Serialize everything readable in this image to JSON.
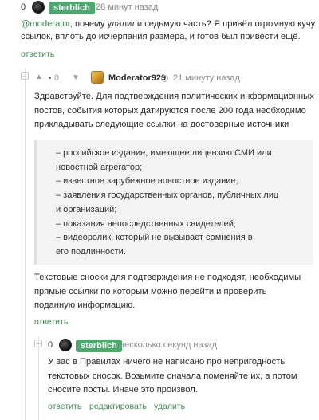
{
  "comment1": {
    "rating": "0",
    "author": "sterblich",
    "time": "28 минут назад",
    "mention": "@moderator",
    "text_rest": ", почему удалили седьмую часть? Я привёл огромную кучу",
    "text_line2": "ссылок, вплоть до исчерпания размера, и готов был привести ещё.",
    "reply_label": "ответить"
  },
  "comment2": {
    "rating": "0",
    "author": "Moderator929",
    "time": "21 минуту назад",
    "intro_lines": [
      "Здравствуйте. Для подтверждения политических информационных",
      "постов, события которых датируются после 200 года необходимо",
      "прикладывать следующие ссылки на достоверные источники"
    ],
    "quote_lines": [
      "– российское издание, имеющее лицензию СМИ или",
      "новостной агрегатор;",
      "– известное зарубежное новостное издание;",
      "– заявления государственных органов, публичных лиц",
      "и организаций;",
      "– показания непосредственных свидетелей;",
      "– видеоролик, который не вызывает сомнения в",
      "его подлинности."
    ],
    "outro_lines": [
      "Текстовые сноски для подтверждения не подходят, необходимы",
      "прямые ссылки по которым можно перейти и проверить",
      "поданную информацию."
    ],
    "reply_label": "ответить"
  },
  "comment3": {
    "rating": "0",
    "author": "sterblich",
    "time": "несколько секунд назад",
    "lines": [
      "У вас в Правилах ничего не написано про непригодность",
      "текстовых сносок. Возьмите сначала поменяйте их, а потом",
      "сносите посты. Иначе это произвол."
    ],
    "actions": {
      "reply": "ответить",
      "edit": "редактировать",
      "delete": "удалить"
    }
  }
}
